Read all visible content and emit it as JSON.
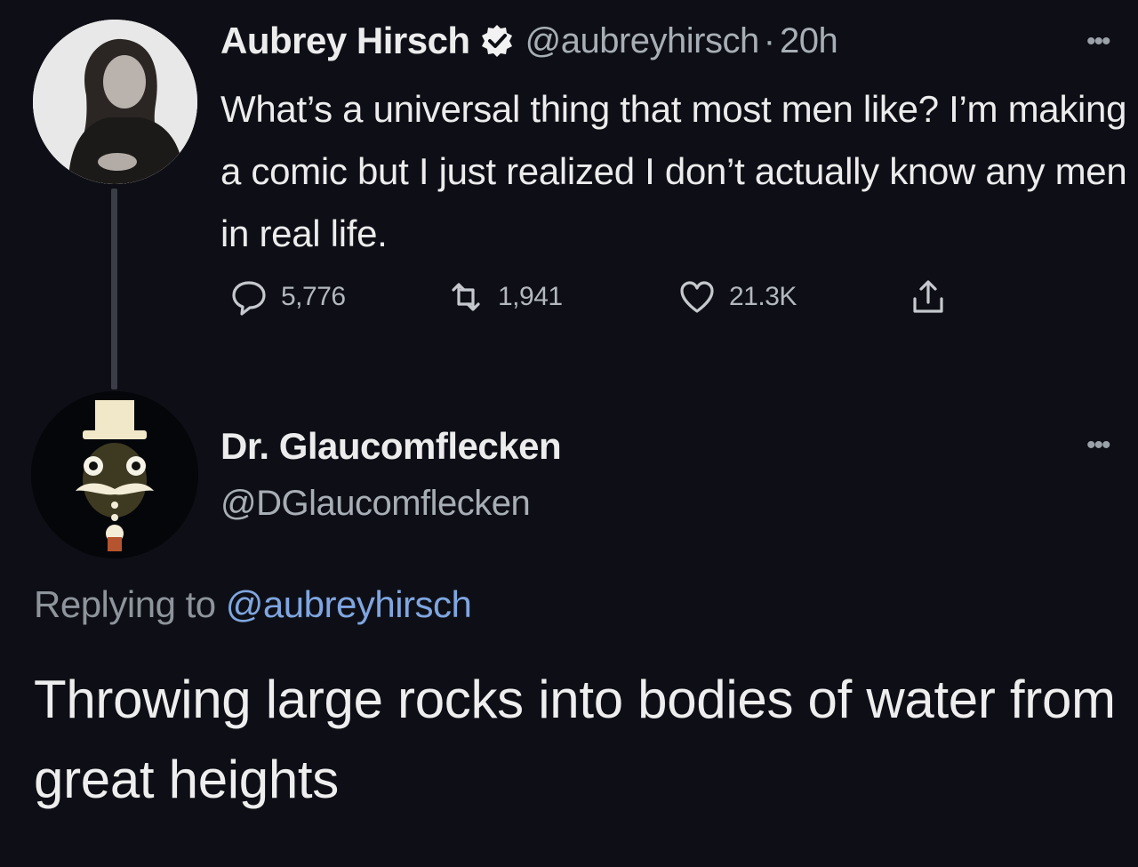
{
  "original_tweet": {
    "display_name": "Aubrey Hirsch",
    "handle": "@aubreyhirsch",
    "separator": "·",
    "time_ago": "20h",
    "text": "What’s a universal thing that most men like? I’m making a comic but I just realized I don’t actually know any men in real life.",
    "counts": {
      "replies": "5,776",
      "retweets": "1,941",
      "likes": "21.3K"
    },
    "icons": [
      "verified-badge-icon",
      "more-options-icon",
      "reply-icon",
      "retweet-icon",
      "like-icon",
      "share-icon"
    ]
  },
  "reply_tweet": {
    "display_name": "Dr. Glaucomflecken",
    "handle": "@DGlaucomflecken",
    "replying_prefix": "Replying to",
    "replying_to": "@aubreyhirsch",
    "text": "Throwing large rocks into bodies of water from great heights",
    "icons": [
      "more-options-icon"
    ]
  },
  "colors": {
    "background": "#0e0f16",
    "primary_text": "#ececec",
    "secondary_text": "#a8aeb5",
    "mention_link": "#7fa6e0"
  }
}
